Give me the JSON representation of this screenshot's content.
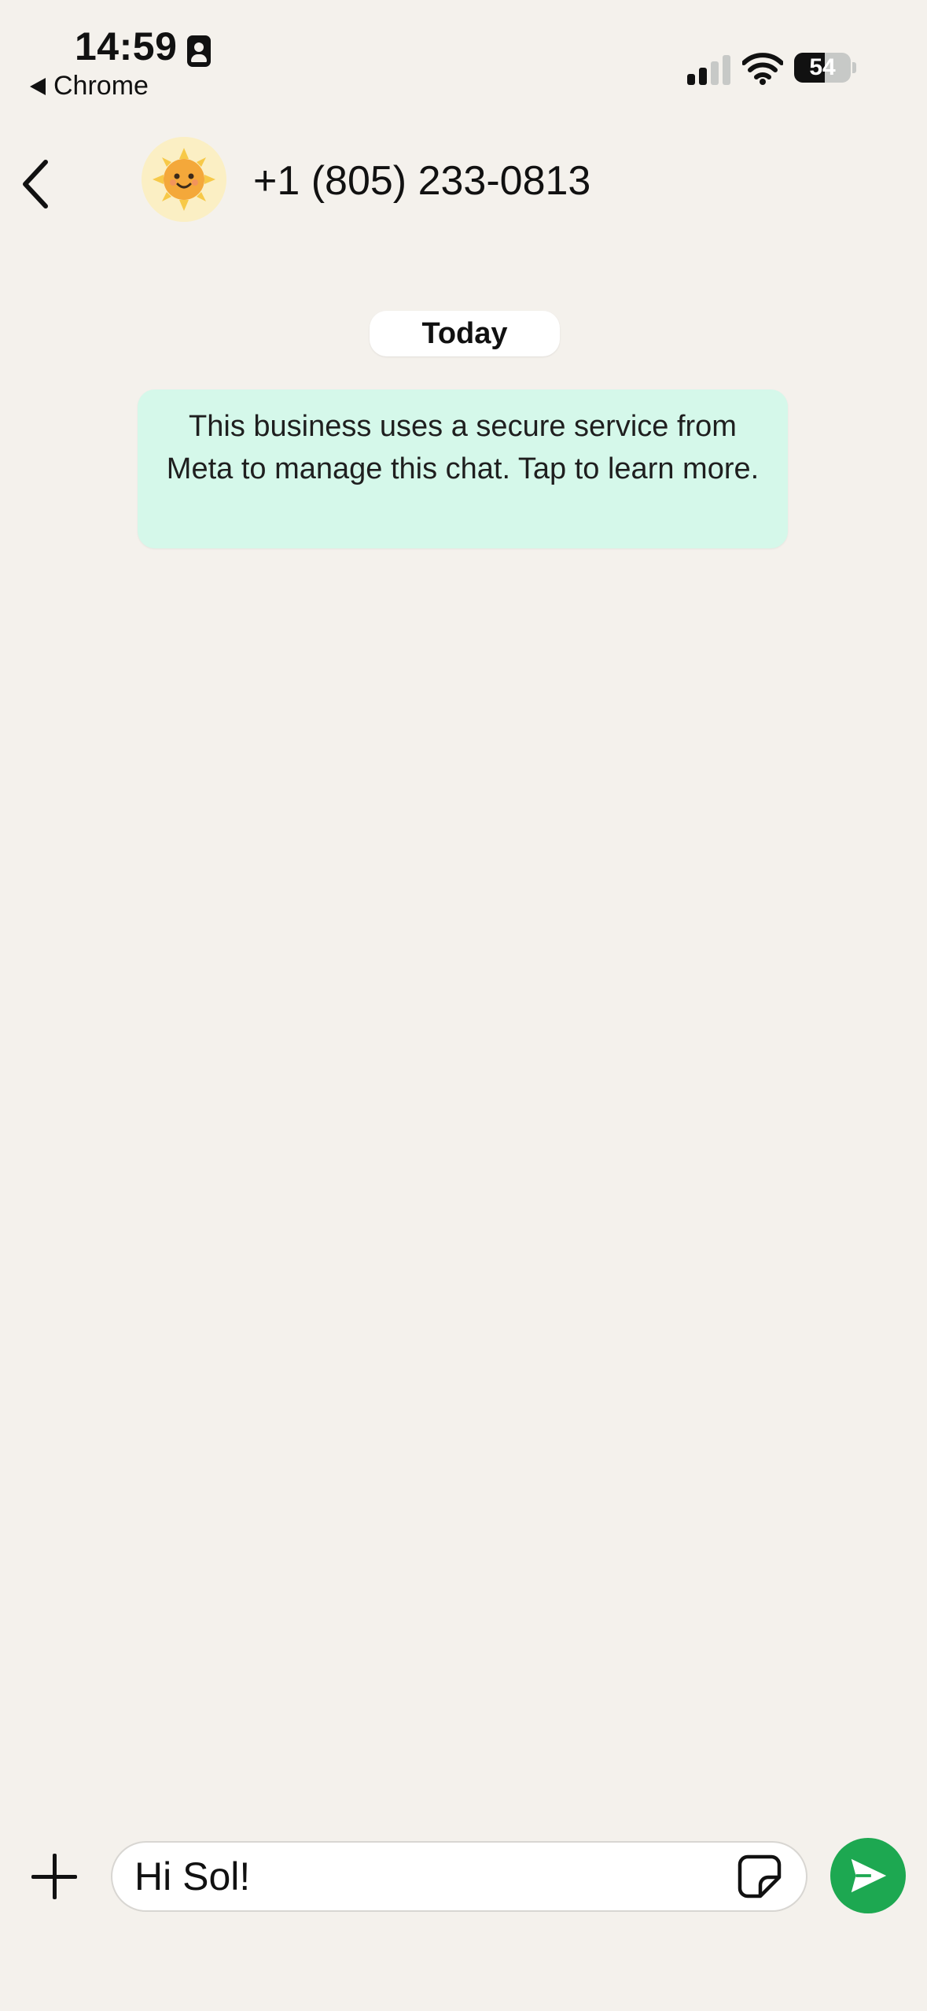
{
  "status_bar": {
    "time": "14:59",
    "back_app_label": "Chrome",
    "battery_percent": "54",
    "battery_level": 0.54
  },
  "header": {
    "contact_name": "+1 (805) 233-0813",
    "avatar_icon": "smiling-sun-icon"
  },
  "chat": {
    "date_label": "Today",
    "notice_text": "This business uses a secure service from Meta to manage this chat. Tap to learn more."
  },
  "composer": {
    "input_value": "Hi Sol!",
    "send_color": "#1da851"
  },
  "colors": {
    "background": "#f4f1ec",
    "notice_bg": "#d5f8ea",
    "accent": "#1da851"
  }
}
